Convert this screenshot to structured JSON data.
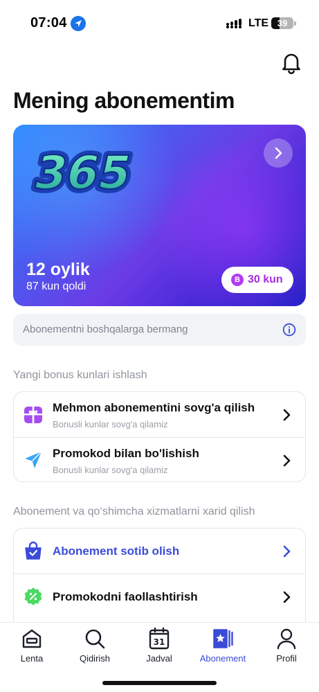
{
  "status_bar": {
    "time": "07:04",
    "network": "LTE",
    "battery": "39",
    "battery_level": 0.39
  },
  "header": {
    "title": "Mening abonementim"
  },
  "subscription_card": {
    "plan_title": "12 oylik",
    "remaining": "87 kun qoldi",
    "bonus_badge": "B",
    "bonus_days": "30 kun",
    "logo_name": "365-logo"
  },
  "share": {
    "text": "Abonementni boshqalarga bermang"
  },
  "bonus_section": {
    "label": "Yangi bonus kunlari ishlash",
    "items": [
      {
        "title": "Mehmon abonementini sovg'a qilish",
        "subtitle": "Bonusli kunlar sovg'a qilamiz",
        "icon": "gift-icon"
      },
      {
        "title": "Promokod bilan bo'lishish",
        "subtitle": "Bonusli kunlar sovg'a qilamiz",
        "icon": "paper-plane-icon"
      }
    ]
  },
  "purchase_section": {
    "label": "Abonement va qo‘shimcha xizmatlarni xarid qilish",
    "items": [
      {
        "title": "Abonement sotib olish",
        "icon": "shopping-bag-icon",
        "accent": "#3b4bd8"
      },
      {
        "title": "Promokodni faollashtirish",
        "icon": "discount-badge-icon"
      }
    ]
  },
  "bottom_nav": {
    "items": [
      {
        "label": "Lenta",
        "icon": "home-icon"
      },
      {
        "label": "Qidirish",
        "icon": "search-icon"
      },
      {
        "label": "Jadval",
        "icon": "calendar-icon",
        "day": "31"
      },
      {
        "label": "Abonement",
        "icon": "subscription-icon",
        "active": true
      },
      {
        "label": "Profil",
        "icon": "profile-icon"
      }
    ]
  },
  "colors": {
    "accent": "#3b4bd8",
    "bonus": "#a52ce0",
    "gift": "#a54ef0",
    "send": "#3aa5f5",
    "promo": "#4cd964"
  }
}
